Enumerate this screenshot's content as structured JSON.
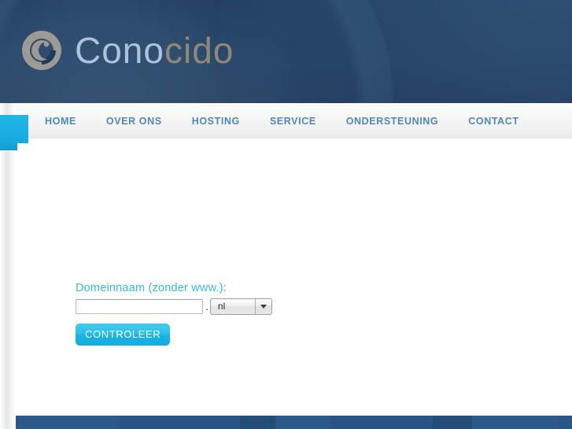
{
  "site": {
    "logo": {
      "mark_name": "conocido-circle-logo",
      "text_part1": "Cono",
      "text_part2": "cido",
      "color_part1": "#a9c3da",
      "color_part2": "#8e8878"
    },
    "header_bg": "#1e3a5c",
    "accent_color": "#18b4e4"
  },
  "nav": {
    "items": [
      {
        "label": "HOME",
        "name": "nav-item-home"
      },
      {
        "label": "OVER ONS",
        "name": "nav-item-over-ons"
      },
      {
        "label": "HOSTING",
        "name": "nav-item-hosting"
      },
      {
        "label": "SERVICE",
        "name": "nav-item-service"
      },
      {
        "label": "ONDERSTEUNING",
        "name": "nav-item-ondersteuning"
      },
      {
        "label": "CONTACT",
        "name": "nav-item-contact"
      }
    ],
    "text_color": "#4d87bd"
  },
  "form": {
    "label": "Domeinnaam (zonder www.):",
    "label_color": "#36bbe8",
    "input_value": "",
    "input_placeholder": "",
    "separator": ".",
    "tld_selected": "nl",
    "tld_options": [
      "nl"
    ],
    "submit_label": "CONTROLEER",
    "submit_color": "#18b4e4"
  },
  "footer": {
    "background": "#2b5888"
  }
}
